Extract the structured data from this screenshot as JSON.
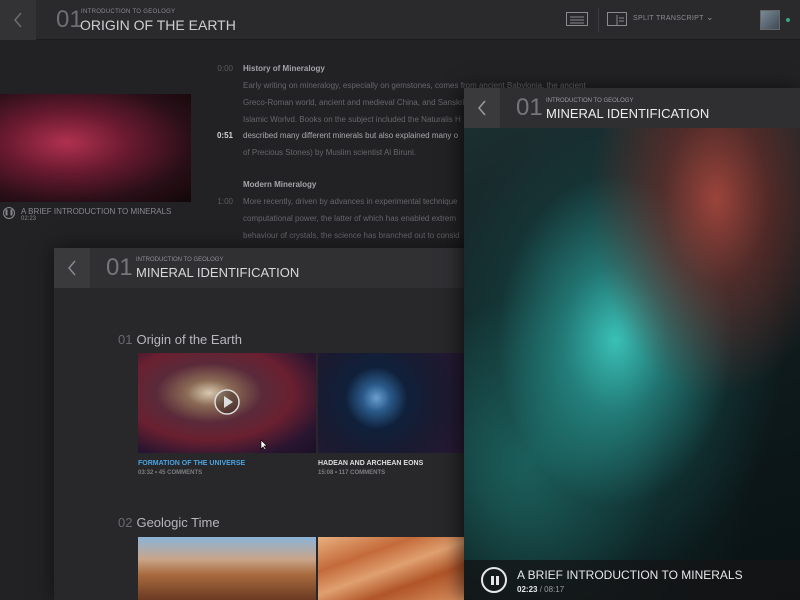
{
  "background": {
    "header": {
      "number": "01",
      "kicker": "INTRODUCTION TO GEOLOGY",
      "title": "ORIGIN OF THE EARTH",
      "split_label": "SPLIT TRANSCRIPT"
    },
    "thumb": {
      "title": "A BRIEF INTRODUCTION TO MINERALS",
      "time": "02:23"
    },
    "transcript": {
      "sections": [
        {
          "time": "0:00",
          "heading": "History of Mineralogy"
        },
        {
          "time": "1:00",
          "heading": "Modern Mineralogy"
        }
      ],
      "lines": [
        "Early writing on mineralogy, especially on gemstones, comes from ancient Babylonia, the ancient",
        "Greco-Roman world, ancient and medieval China, and Sanskrit",
        "Islamic Worlvd. Books on the subject included the Naturalis H",
        "described many different minerals but also explained many o",
        "of Precious Stones) by Muslim scientist Al Biruni.",
        "More recently, driven by advances in experimental technique",
        "computational power, the latter of which has enabled extrem",
        "behaviour of crystals, the science has branched out to consid"
      ],
      "active_time": "0:51"
    }
  },
  "middle": {
    "header": {
      "number": "01",
      "kicker": "INTRODUCTION TO GEOLOGY",
      "title": "MINERAL IDENTIFICATION"
    },
    "sections": [
      {
        "number": "01",
        "title": "Origin of the Earth",
        "cards": [
          {
            "title": "FORMATION OF THE UNIVERSE",
            "duration": "03:32",
            "comments": "45 COMMENTS",
            "active": true
          },
          {
            "title": "HADEAN AND ARCHEAN EONS",
            "duration": "15:08",
            "comments": "117 COMMENTS",
            "active": false
          }
        ]
      },
      {
        "number": "02",
        "title": "Geologic Time"
      }
    ]
  },
  "front": {
    "header": {
      "number": "01",
      "kicker": "INTRODUCTION TO GEOLOGY",
      "title": "MINERAL IDENTIFICATION"
    },
    "player": {
      "title": "A BRIEF INTRODUCTION TO MINERALS",
      "current": "02:23",
      "total": "08:17"
    }
  },
  "colors": {
    "accent": "#4aa3df",
    "online": "#3aa57e"
  },
  "icons": [
    "back-chevron-icon",
    "list-view-icon",
    "split-transcript-icon",
    "chevron-down-icon",
    "pause-icon",
    "play-icon",
    "cursor-icon"
  ]
}
